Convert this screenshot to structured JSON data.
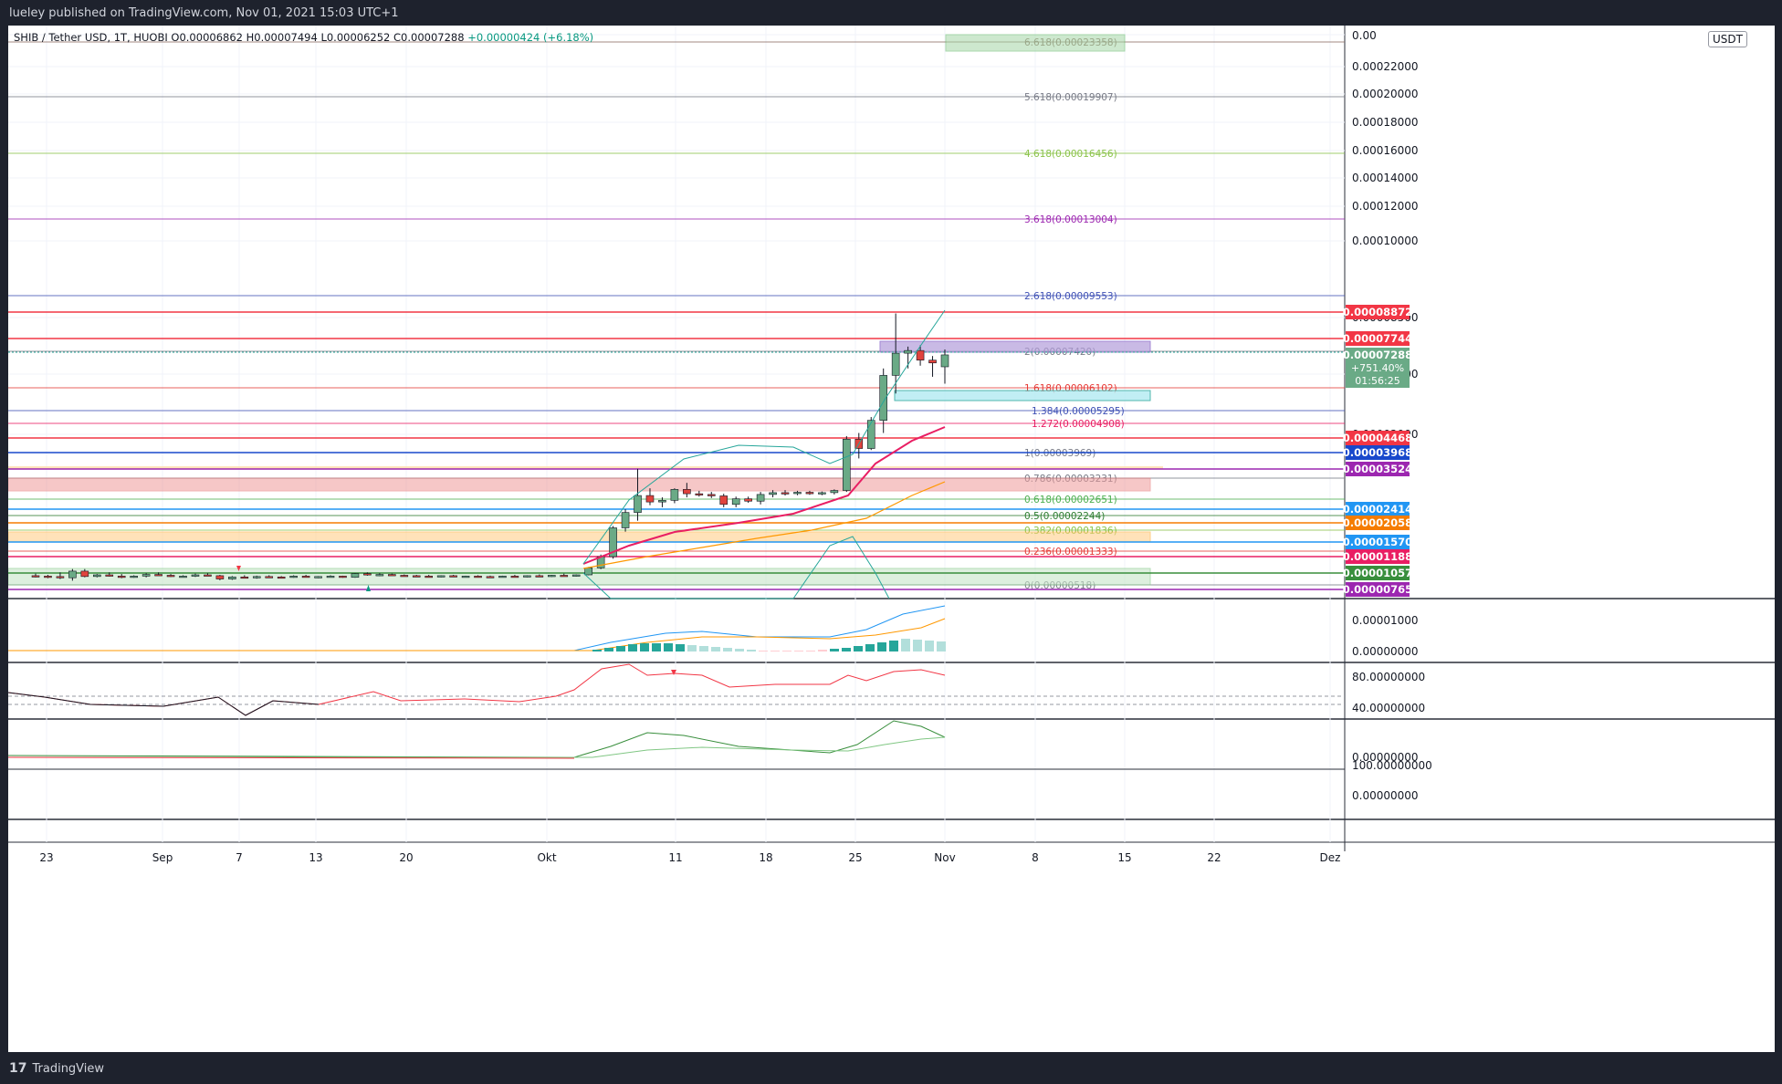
{
  "header": {
    "published": "lueley published on TradingView.com, Nov 01, 2021 15:03 UTC+1"
  },
  "legend": {
    "symbol": "SHIB / Tether USD, 1T, HUOBI",
    "o": "O0.00006862",
    "h": "H0.00007494",
    "l": "L0.00006252",
    "c": "C0.00007288",
    "chg": "+0.00000424 (+6.18%)"
  },
  "currency_badge": "USDT",
  "footer": {
    "brand": "TradingView",
    "logo_glyph": "17"
  },
  "colors": {
    "up": "#6aaa86",
    "down": "#e0433d",
    "bg": "#ffffff",
    "frame": "#1e222d"
  },
  "chart_data": {
    "type": "candlestick",
    "price_axis_labels": [
      "0.00022000",
      "0.00020000",
      "0.00018000",
      "0.00016000",
      "0.00014000",
      "0.00012000",
      "0.00010000",
      "0.00008500",
      "0.00005500",
      "0.00002900"
    ],
    "price_axis_top_label": "0.00",
    "time_axis_labels": [
      "23",
      "Sep",
      "7",
      "13",
      "20",
      "Okt",
      "11",
      "18",
      "25",
      "Nov",
      "8",
      "15",
      "22",
      "Dez"
    ],
    "price_badges": [
      {
        "text": "0.00008872",
        "color": "#f23645"
      },
      {
        "text": "0.00007744",
        "color": "#f23645"
      },
      {
        "text": "0.00007288",
        "color": "#6aaa86",
        "extra": [
          "+751.40%",
          "01:56:25"
        ]
      },
      {
        "text": "0.00004468",
        "color": "#f23645"
      },
      {
        "text": "0.00003968",
        "color": "#1848cc"
      },
      {
        "text": "0.00003524",
        "color": "#9c27b0"
      },
      {
        "text": "0.00002414",
        "color": "#2196f3"
      },
      {
        "text": "0.00002058",
        "color": "#f57c00"
      },
      {
        "text": "0.00001570",
        "color": "#2196f3"
      },
      {
        "text": "0.00001188",
        "color": "#e91e63"
      },
      {
        "text": "0.00001057",
        "color": "#388e3c"
      },
      {
        "text": "0.00000765",
        "color": "#9c27b0"
      }
    ],
    "fib_levels": [
      {
        "label": "6.618(0.00023358)",
        "color": "#8d6e63"
      },
      {
        "label": "5.618(0.00019907)",
        "color": "#787b86"
      },
      {
        "label": "4.618(0.00016456)",
        "color": "#8bc34a"
      },
      {
        "label": "3.618(0.00013004)",
        "color": "#9c27b0"
      },
      {
        "label": "2.618(0.00009553)",
        "color": "#3f51b5"
      },
      {
        "label": "2(0.00007420)",
        "color": "#787b86"
      },
      {
        "label": "1.618(0.00006102)",
        "color": "#e53935"
      },
      {
        "label": "1.384(0.00005295)",
        "color": "#3f51b5"
      },
      {
        "label": "1.272(0.00004908)",
        "color": "#e91e63"
      },
      {
        "label": "1(0.00003969)",
        "color": "#787b86"
      },
      {
        "label": "0.786(0.00003231)",
        "color": "#787b86"
      },
      {
        "label": "0.618(0.00002651)",
        "color": "#4caf50"
      },
      {
        "label": "0.5(0.00002244)",
        "color": "#2e7d32"
      },
      {
        "label": "0.382(0.00001836)",
        "color": "#8bc34a"
      },
      {
        "label": "0.236(0.00001333)",
        "color": "#e53935"
      },
      {
        "label": "0(0.00000518)",
        "color": "#787b86"
      }
    ],
    "macd_axis_labels": [
      "0.00001000",
      "0.00000000"
    ],
    "rsi_axis_labels": [
      "80.00000000",
      "40.00000000"
    ],
    "osc_axis_labels": [
      "0.00000000",
      "100.00000000",
      "0.00000000"
    ],
    "candles": [
      {
        "o": 7.4e-06,
        "h": 7.9e-06,
        "l": 7e-06,
        "c": 7.3e-06
      },
      {
        "o": 7.3e-06,
        "h": 7.6e-06,
        "l": 6.8e-06,
        "c": 7.2e-06
      },
      {
        "o": 7.2e-06,
        "h": 8.2e-06,
        "l": 6.6e-06,
        "c": 6.9e-06
      },
      {
        "o": 6.9e-06,
        "h": 9e-06,
        "l": 6.2e-06,
        "c": 8.5e-06
      },
      {
        "o": 8.5e-06,
        "h": 9e-06,
        "l": 7e-06,
        "c": 7.2e-06
      },
      {
        "o": 7.2e-06,
        "h": 7.8e-06,
        "l": 7e-06,
        "c": 7.6e-06
      },
      {
        "o": 7.6e-06,
        "h": 8.2e-06,
        "l": 7.2e-06,
        "c": 7.3e-06
      },
      {
        "o": 7.3e-06,
        "h": 7.8e-06,
        "l": 6.8e-06,
        "c": 7.1e-06
      },
      {
        "o": 7.1e-06,
        "h": 7.5e-06,
        "l": 6.9e-06,
        "c": 7.3e-06
      },
      {
        "o": 7.3e-06,
        "h": 8e-06,
        "l": 7e-06,
        "c": 7.7e-06
      },
      {
        "o": 7.7e-06,
        "h": 8.2e-06,
        "l": 7.4e-06,
        "c": 7.5e-06
      },
      {
        "o": 7.5e-06,
        "h": 7.8e-06,
        "l": 7.1e-06,
        "c": 7.2e-06
      },
      {
        "o": 7.2e-06,
        "h": 7.5e-06,
        "l": 7e-06,
        "c": 7.3e-06
      },
      {
        "o": 7.3e-06,
        "h": 7.9e-06,
        "l": 7.1e-06,
        "c": 7.6e-06
      },
      {
        "o": 7.6e-06,
        "h": 8e-06,
        "l": 7.3e-06,
        "c": 7.4e-06
      },
      {
        "o": 7.4e-06,
        "h": 7.6e-06,
        "l": 6.3e-06,
        "c": 6.6e-06
      },
      {
        "o": 6.6e-06,
        "h": 7.3e-06,
        "l": 6.4e-06,
        "c": 7.1e-06
      },
      {
        "o": 7.1e-06,
        "h": 7.5e-06,
        "l": 6.8e-06,
        "c": 6.9e-06
      },
      {
        "o": 6.9e-06,
        "h": 7.4e-06,
        "l": 6.7e-06,
        "c": 7.2e-06
      },
      {
        "o": 7.2e-06,
        "h": 7.5e-06,
        "l": 7e-06,
        "c": 7.1e-06
      },
      {
        "o": 7.1e-06,
        "h": 7.3e-06,
        "l": 6.8e-06,
        "c": 7e-06
      },
      {
        "o": 7e-06,
        "h": 7.5e-06,
        "l": 6.9e-06,
        "c": 7.3e-06
      },
      {
        "o": 7.3e-06,
        "h": 7.6e-06,
        "l": 7e-06,
        "c": 7.1e-06
      },
      {
        "o": 7.1e-06,
        "h": 7.3e-06,
        "l": 6.8e-06,
        "c": 7.2e-06
      },
      {
        "o": 7.2e-06,
        "h": 7.5e-06,
        "l": 7e-06,
        "c": 7.3e-06
      },
      {
        "o": 7.3e-06,
        "h": 7.4e-06,
        "l": 6.9e-06,
        "c": 7e-06
      },
      {
        "o": 7e-06,
        "h": 8e-06,
        "l": 6.9e-06,
        "c": 7.9e-06
      },
      {
        "o": 7.9e-06,
        "h": 8.2e-06,
        "l": 7.4e-06,
        "c": 7.6e-06
      },
      {
        "o": 7.6e-06,
        "h": 8e-06,
        "l": 7.3e-06,
        "c": 7.7e-06
      },
      {
        "o": 7.7e-06,
        "h": 7.9e-06,
        "l": 7.4e-06,
        "c": 7.5e-06
      },
      {
        "o": 7.5e-06,
        "h": 7.7e-06,
        "l": 7.2e-06,
        "c": 7.4e-06
      },
      {
        "o": 7.4e-06,
        "h": 7.6e-06,
        "l": 7.1e-06,
        "c": 7.3e-06
      },
      {
        "o": 7.3e-06,
        "h": 7.6e-06,
        "l": 7e-06,
        "c": 7.2e-06
      },
      {
        "o": 7.2e-06,
        "h": 7.5e-06,
        "l": 7e-06,
        "c": 7.4e-06
      },
      {
        "o": 7.4e-06,
        "h": 7.6e-06,
        "l": 7.1e-06,
        "c": 7.2e-06
      },
      {
        "o": 7.2e-06,
        "h": 7.4e-06,
        "l": 7e-06,
        "c": 7.3e-06
      },
      {
        "o": 7.3e-06,
        "h": 7.5e-06,
        "l": 7.1e-06,
        "c": 7.2e-06
      },
      {
        "o": 7.2e-06,
        "h": 7.4e-06,
        "l": 7e-06,
        "c": 7.1e-06
      },
      {
        "o": 7.1e-06,
        "h": 7.4e-06,
        "l": 7e-06,
        "c": 7.3e-06
      },
      {
        "o": 7.3e-06,
        "h": 7.6e-06,
        "l": 7.1e-06,
        "c": 7.2e-06
      },
      {
        "o": 7.2e-06,
        "h": 7.5e-06,
        "l": 7e-06,
        "c": 7.4e-06
      },
      {
        "o": 7.4e-06,
        "h": 7.7e-06,
        "l": 7.2e-06,
        "c": 7.3e-06
      },
      {
        "o": 7.3e-06,
        "h": 7.6e-06,
        "l": 7.1e-06,
        "c": 7.5e-06
      },
      {
        "o": 7.5e-06,
        "h": 7.9e-06,
        "l": 7.3e-06,
        "c": 7.4e-06
      },
      {
        "o": 7.4e-06,
        "h": 7.7e-06,
        "l": 7.2e-06,
        "c": 7.6e-06
      },
      {
        "o": 7.6e-06,
        "h": 9.5e-06,
        "l": 7.5e-06,
        "c": 9.3e-06
      },
      {
        "o": 9.3e-06,
        "h": 1.25e-05,
        "l": 9e-06,
        "c": 1.2e-05
      },
      {
        "o": 1.2e-05,
        "h": 1.95e-05,
        "l": 1.15e-05,
        "c": 1.9e-05
      },
      {
        "o": 1.9e-05,
        "h": 2.4e-05,
        "l": 1.8e-05,
        "c": 2.32e-05
      },
      {
        "o": 2.32e-05,
        "h": 3.5e-05,
        "l": 2.1e-05,
        "c": 2.75e-05
      },
      {
        "o": 2.75e-05,
        "h": 2.95e-05,
        "l": 2.5e-05,
        "c": 2.58e-05
      },
      {
        "o": 2.58e-05,
        "h": 2.7e-05,
        "l": 2.45e-05,
        "c": 2.62e-05
      },
      {
        "o": 2.62e-05,
        "h": 2.95e-05,
        "l": 2.55e-05,
        "c": 2.92e-05
      },
      {
        "o": 2.92e-05,
        "h": 3.1e-05,
        "l": 2.7e-05,
        "c": 2.8e-05
      },
      {
        "o": 2.8e-05,
        "h": 2.88e-05,
        "l": 2.72e-05,
        "c": 2.78e-05
      },
      {
        "o": 2.78e-05,
        "h": 2.85e-05,
        "l": 2.68e-05,
        "c": 2.74e-05
      },
      {
        "o": 2.74e-05,
        "h": 2.8e-05,
        "l": 2.45e-05,
        "c": 2.52e-05
      },
      {
        "o": 2.52e-05,
        "h": 2.72e-05,
        "l": 2.45e-05,
        "c": 2.66e-05
      },
      {
        "o": 2.66e-05,
        "h": 2.72e-05,
        "l": 2.56e-05,
        "c": 2.6e-05
      },
      {
        "o": 2.6e-05,
        "h": 2.85e-05,
        "l": 2.52e-05,
        "c": 2.78e-05
      },
      {
        "o": 2.78e-05,
        "h": 2.9e-05,
        "l": 2.7e-05,
        "c": 2.83e-05
      },
      {
        "o": 2.83e-05,
        "h": 2.9e-05,
        "l": 2.75e-05,
        "c": 2.82e-05
      },
      {
        "o": 2.82e-05,
        "h": 2.88e-05,
        "l": 2.76e-05,
        "c": 2.84e-05
      },
      {
        "o": 2.84e-05,
        "h": 2.88e-05,
        "l": 2.77e-05,
        "c": 2.8e-05
      },
      {
        "o": 2.8e-05,
        "h": 2.86e-05,
        "l": 2.76e-05,
        "c": 2.83e-05
      },
      {
        "o": 2.83e-05,
        "h": 2.92e-05,
        "l": 2.78e-05,
        "c": 2.89e-05
      },
      {
        "o": 2.89e-05,
        "h": 4.5e-05,
        "l": 2.85e-05,
        "c": 4.4e-05
      },
      {
        "o": 4.4e-05,
        "h": 4.6e-05,
        "l": 3.8e-05,
        "c": 4.1e-05
      },
      {
        "o": 4.1e-05,
        "h": 5.1e-05,
        "l": 4.05e-05,
        "c": 5e-05
      },
      {
        "o": 5e-05,
        "h": 6.8e-05,
        "l": 4.6e-05,
        "c": 6.55e-05
      },
      {
        "o": 6.55e-05,
        "h": 8.87e-05,
        "l": 5.9e-05,
        "c": 7.35e-05
      },
      {
        "o": 7.35e-05,
        "h": 7.6e-05,
        "l": 6.8e-05,
        "c": 7.45e-05
      },
      {
        "o": 7.45e-05,
        "h": 7.65e-05,
        "l": 6.9e-05,
        "c": 7.1e-05
      },
      {
        "o": 7.1e-05,
        "h": 7.25e-05,
        "l": 6.5e-05,
        "c": 7e-05
      },
      {
        "o": 6.86e-05,
        "h": 7.49e-05,
        "l": 6.25e-05,
        "c": 7.29e-05
      }
    ]
  }
}
